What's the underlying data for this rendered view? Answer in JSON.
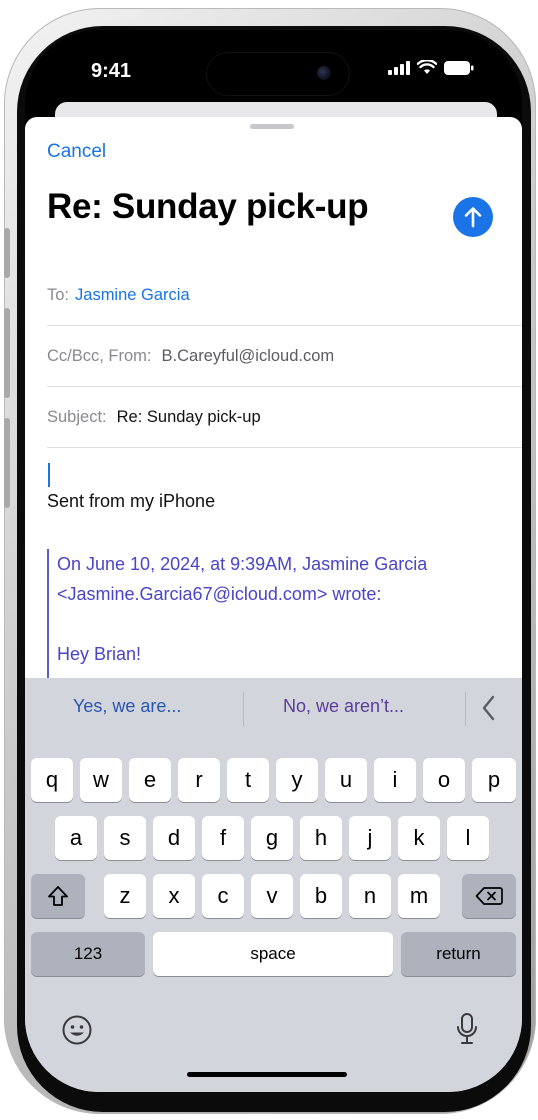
{
  "status_bar": {
    "time": "9:41"
  },
  "compose": {
    "cancel_label": "Cancel",
    "title": "Re: Sunday pick-up",
    "to_label": "To:",
    "to_value": "Jasmine Garcia",
    "ccbcc_label": "Cc/Bcc, From:",
    "from_value": "B.Careyful@icloud.com",
    "subject_label": "Subject:",
    "subject_value": "Re: Sunday pick-up",
    "signature": "Sent from my iPhone",
    "quote_line1": "On June 10, 2024, at 9:39AM, Jasmine Garcia",
    "quote_line2": "<Jasmine.Garcia67@icloud.com> wrote:",
    "quote_line3": "Hey Brian!"
  },
  "keyboard": {
    "suggestion_1": "Yes, we are...",
    "suggestion_2": "No, we aren’t...",
    "row1": [
      "q",
      "w",
      "e",
      "r",
      "t",
      "y",
      "u",
      "i",
      "o",
      "p"
    ],
    "row2": [
      "a",
      "s",
      "d",
      "f",
      "g",
      "h",
      "j",
      "k",
      "l"
    ],
    "row3": [
      "z",
      "x",
      "c",
      "v",
      "b",
      "n",
      "m"
    ],
    "numbers_label": "123",
    "space_label": "space",
    "return_label": "return"
  },
  "colors": {
    "accent": "#1a74e8",
    "quote": "#4a44c8",
    "keyboard_bg": "#d3d5dc"
  },
  "icons": [
    "send-icon",
    "signal-icon",
    "wifi-icon",
    "battery-icon",
    "shift-icon",
    "delete-icon",
    "emoji-icon",
    "microphone-icon",
    "chevron-left-icon"
  ]
}
